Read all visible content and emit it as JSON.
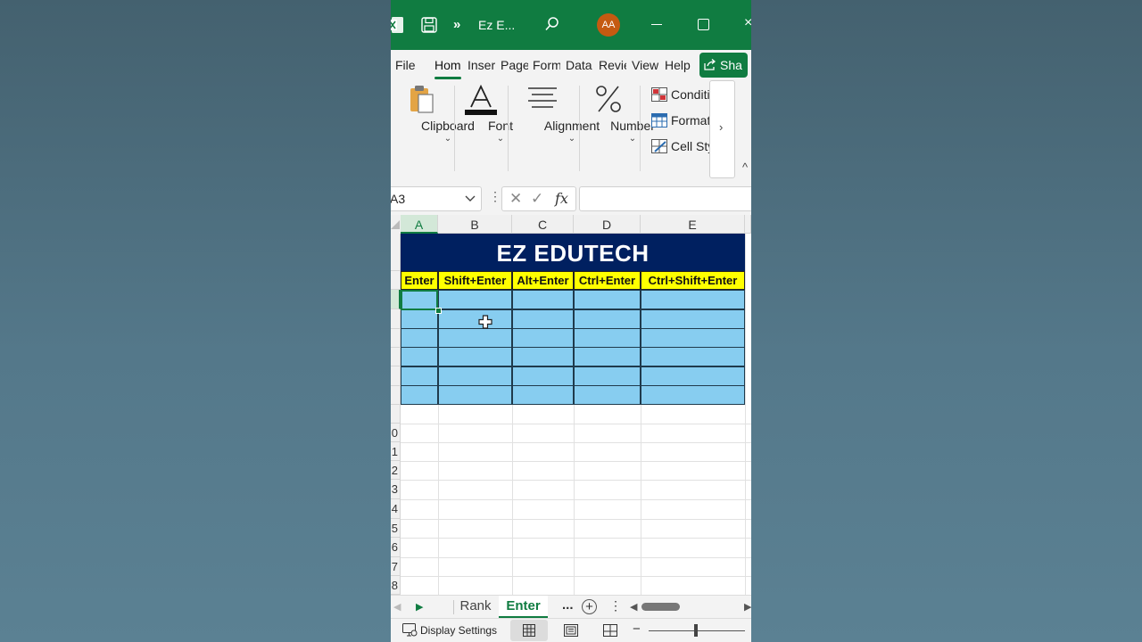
{
  "titlebar": {
    "more": "»",
    "title": "Ez E...",
    "avatar_initials": "AA",
    "close": "×"
  },
  "ribbon_tabs": [
    {
      "label": "File"
    },
    {
      "label": "Hom"
    },
    {
      "label": "Inser"
    },
    {
      "label": "Page"
    },
    {
      "label": "Form"
    },
    {
      "label": "Data"
    },
    {
      "label": "Revie"
    },
    {
      "label": "View"
    },
    {
      "label": "Help"
    }
  ],
  "share_label": "Sha",
  "ribbon_groups": {
    "clipboard": "Clipboard",
    "font": "Font",
    "alignment": "Alignment",
    "number": "Number",
    "chevron": "⌄"
  },
  "styles": {
    "conditional": "Conditi",
    "format": "Format",
    "cell_styles": "Cell Styl"
  },
  "ribbon_scroll": "›",
  "ribbon_collapse": "^",
  "formula_bar": {
    "name_box": "A3",
    "cancel": "✕",
    "enter": "✓",
    "fx": "fx",
    "value": ""
  },
  "grid": {
    "columns": [
      "A",
      "B",
      "C",
      "D",
      "E"
    ],
    "row_labels": [
      "0",
      "1",
      "2",
      "3",
      "4",
      "5",
      "6",
      "7",
      "8"
    ],
    "banner_title": "EZ EDUTECH",
    "headers": [
      "Enter",
      "Shift+Enter",
      "Alt+Enter",
      "Ctrl+Enter",
      "Ctrl+Shift+Enter"
    ]
  },
  "sheets": {
    "tabs": [
      "Rank",
      "Enter"
    ],
    "active": "Enter",
    "more": "...",
    "add": "+"
  },
  "statusbar": {
    "display_settings": "Display Settings",
    "zoom_minus": "−"
  },
  "colors": {
    "excel_green": "#107c41",
    "banner_navy": "#002060",
    "header_yellow": "#ffff00",
    "table_blue": "#87cdf0"
  }
}
